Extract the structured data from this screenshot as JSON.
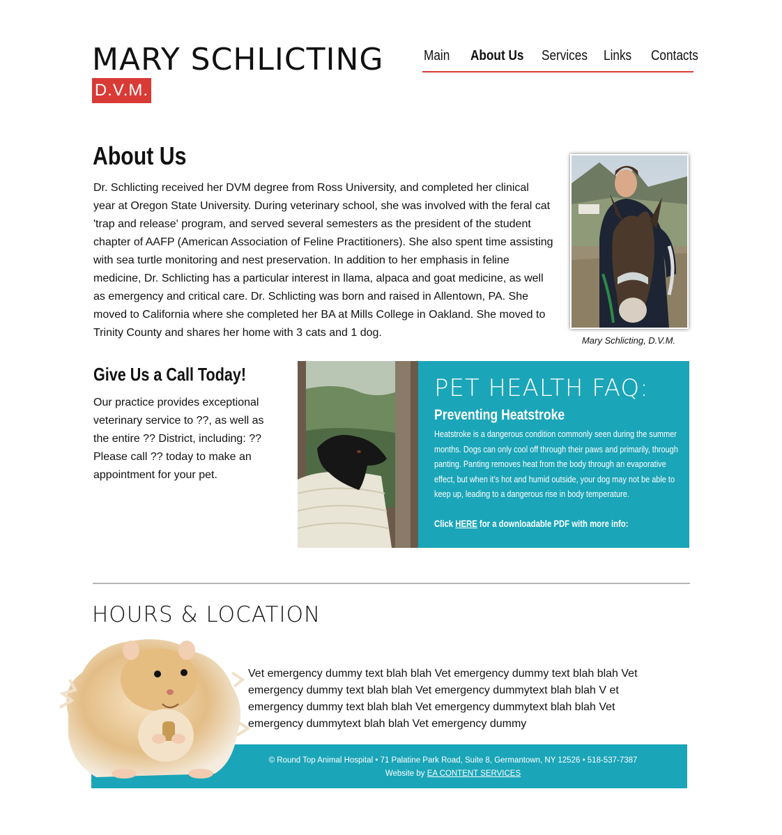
{
  "header": {
    "brand_name": "MARY SCHLICTING",
    "brand_badge": "D.V.M.",
    "nav": [
      {
        "label": "Main",
        "active": false
      },
      {
        "label": "About Us",
        "active": true
      },
      {
        "label": "Services",
        "active": false
      },
      {
        "label": "Links",
        "active": false
      },
      {
        "label": "Contacts",
        "active": false
      }
    ]
  },
  "about": {
    "title": "About Us",
    "body": "Dr. Schlicting received her DVM degree from Ross University, and completed her clinical year at Oregon State University. During veterinary school, she was involved with the feral cat 'trap and release' program, and served several semesters as the president of the student chapter of AAFP (American Association of Feline Practitioners). She also spent time assisting with sea turtle monitoring and nest preservation. In addition to her emphasis in feline medicine, Dr. Schlicting has a particular interest in llama, alpaca and goat medicine, as well as emergency and critical care. Dr. Schlicting was born and raised in Allentown, PA.  She moved to California where she completed her BA at Mills College in Oakland. She moved to Trinity County and shares her home with 3 cats and 1 dog.",
    "photo_caption": "Mary Schlicting, D.V.M."
  },
  "call": {
    "title": "Give Us a Call Today!",
    "body": "Our practice provides exceptional veterinary service to ??, as well as the entire ?? District, including: ?? Please call ?? today to make an appointment for your pet."
  },
  "faq": {
    "title": "PET HEALTH FAQ:",
    "subtitle": "Preventing Heatstroke",
    "body": "Heatstroke is a dangerous condition commonly seen during the summer months. Dogs can only cool off through their paws and primarily, through panting. Panting removes heat from the body through an evaporative effect, but when it’s hot and humid outside, your dog may not be able to keep up, leading to a dangerous rise in body temperature.",
    "cta_prefix": "Click ",
    "cta_link": "HERE",
    "cta_suffix": " for a downloadable PDF with more info:"
  },
  "hours": {
    "title": "HOURS & LOCATION",
    "body": "Vet emergency dummy text blah blah Vet emergency dummy text blah blah Vet emergency dummy text blah blah Vet emergency dummytext blah blah V et emergency dummy text blah blah Vet emergency dummytext blah blah Vet emergency dummytext blah blah Vet emergency dummy"
  },
  "footer": {
    "line1": "© Round Top Animal Hospital •  71 Palatine Park Road, Suite 8, Germantown, NY 12526  • 518-537-7387",
    "website_prefix": "Website by ",
    "website_link": "EA CONTENT SERVICES"
  },
  "colors": {
    "accent_red": "#d93a35",
    "accent_teal": "#1ba5b8"
  }
}
